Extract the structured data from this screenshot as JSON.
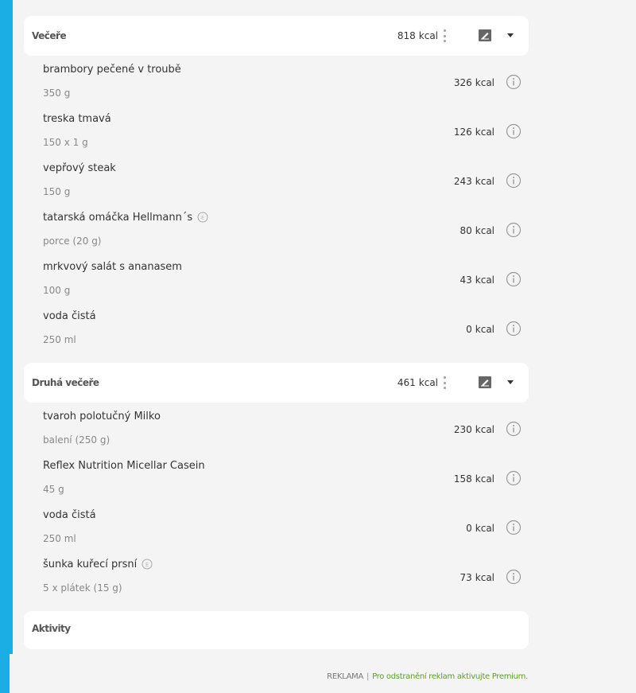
{
  "meals": [
    {
      "title": "Večeře",
      "kcal": "818",
      "unit": "kcal",
      "items": [
        {
          "name": "brambory pečené v troubě",
          "amount": "350 g",
          "kcal": "326",
          "unit": "kcal"
        },
        {
          "name": "treska tmavá",
          "amount": "150 x 1 g",
          "kcal": "126",
          "unit": "kcal"
        },
        {
          "name": "vepřový steak",
          "amount": "150 g",
          "kcal": "243",
          "unit": "kcal"
        },
        {
          "name": "tatarská omáčka Hellmann´s",
          "amount": "porce (20 g)",
          "kcal": "80",
          "unit": "kcal"
        },
        {
          "name": "mrkvový salát s ananasem",
          "amount": "100 g",
          "kcal": "43",
          "unit": "kcal"
        },
        {
          "name": "voda čistá",
          "amount": "250 ml",
          "kcal": "0",
          "unit": "kcal"
        }
      ]
    },
    {
      "title": "Druhá večeře",
      "kcal": "461",
      "unit": "kcal",
      "items": [
        {
          "name": "tvaroh polotučný Milko",
          "amount": "balení (250 g)",
          "kcal": "230",
          "unit": "kcal"
        },
        {
          "name": "Reflex Nutrition Micellar Casein",
          "amount": "45 g",
          "kcal": "158",
          "unit": "kcal"
        },
        {
          "name": "voda čistá",
          "amount": "250 ml",
          "kcal": "0",
          "unit": "kcal"
        },
        {
          "name": "šunka kuřecí prsní",
          "amount": "5 x plátek (15 g)",
          "kcal": "73",
          "unit": "kcal"
        }
      ]
    }
  ],
  "activities": {
    "title": "Aktivity"
  },
  "ad": {
    "label": "REKLAMA",
    "separator": "|",
    "premium_text": "Pro odstranění reklam aktivujte Premium."
  },
  "colors": {
    "background": "#1aaee5",
    "panel": "#f4f4f4",
    "card": "#ffffff",
    "premium_link": "#5aa02c"
  },
  "icons": {
    "more": "vertical-dots-icon",
    "note": "note-icon",
    "expand": "caret-down-icon",
    "info": "info-icon",
    "badge": "e-badge-icon"
  }
}
